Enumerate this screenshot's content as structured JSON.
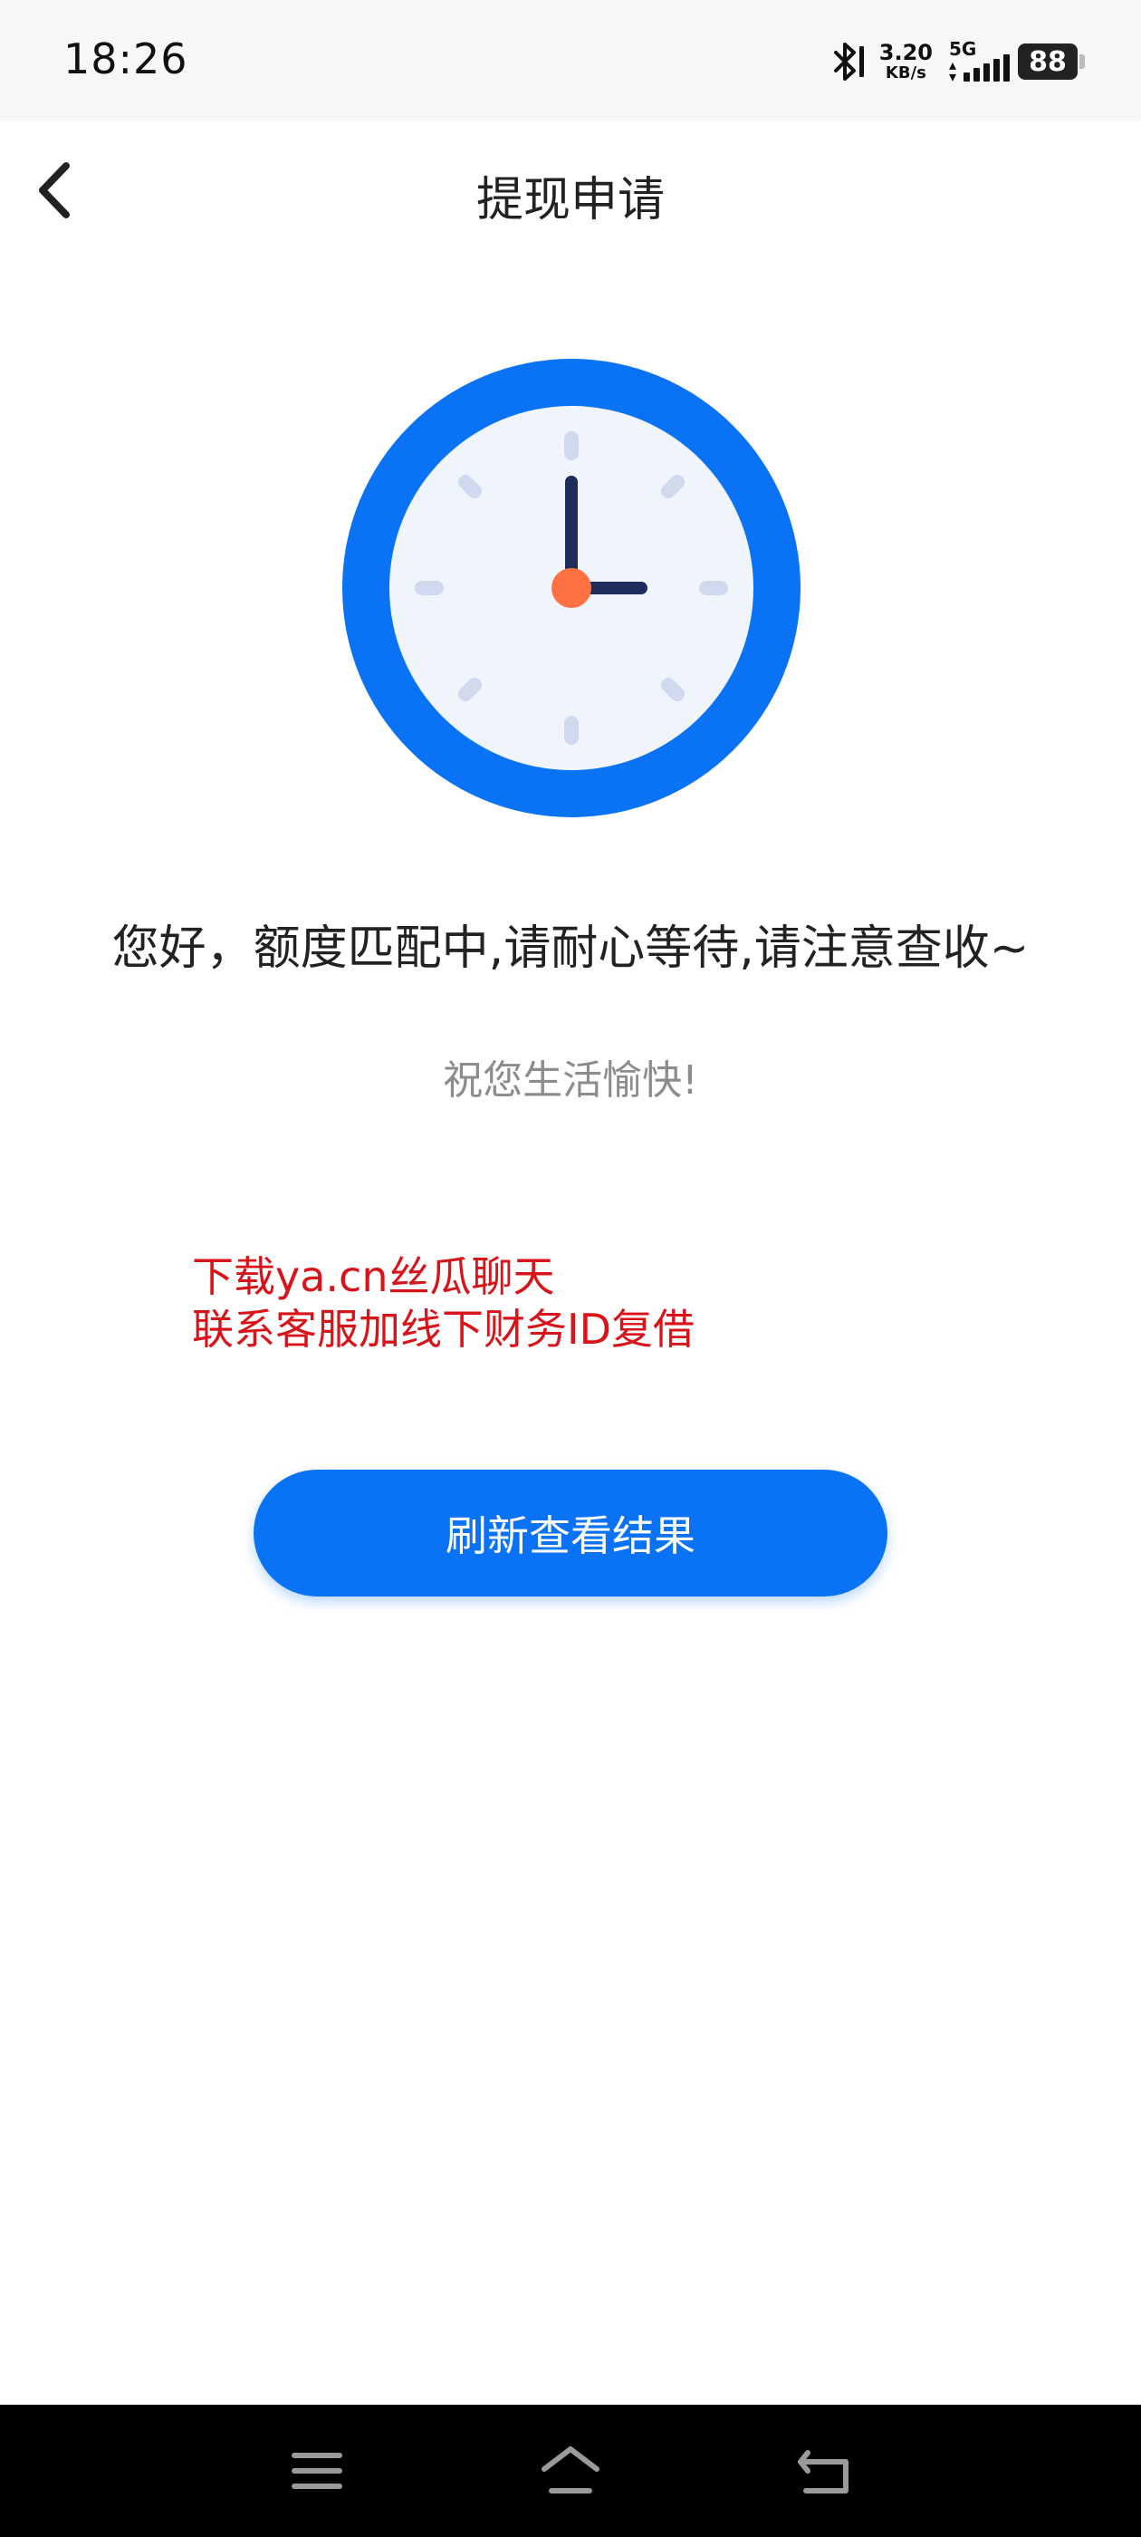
{
  "status_bar": {
    "time": "18:26",
    "net_speed_value": "3.20",
    "net_speed_unit": "KB/s",
    "network_type": "5G",
    "battery": "88",
    "icons": [
      "bluetooth-icon",
      "signal-icon",
      "battery-icon"
    ]
  },
  "header": {
    "title": "提现申请",
    "back_icon": "chevron-left-icon"
  },
  "main": {
    "illustration": "clock-icon",
    "message": "您好，额度匹配中,请耐心等待,请注意查收~",
    "sub_message": "祝您生活愉快!",
    "notice_lines": [
      "下载ya.cn丝瓜聊天",
      "联系客服加线下财务ID复借"
    ],
    "refresh_button_label": "刷新查看结果"
  },
  "nav_bar": {
    "icons": [
      "menu-icon",
      "home-icon",
      "back-icon"
    ]
  },
  "colors": {
    "primary": "#0a72f5",
    "clock_face": "#f0f4fb",
    "clock_hands": "#1f2d5c",
    "clock_center": "#ff7043",
    "notice": "#d8141a",
    "sub_text": "#8c8c8c"
  }
}
